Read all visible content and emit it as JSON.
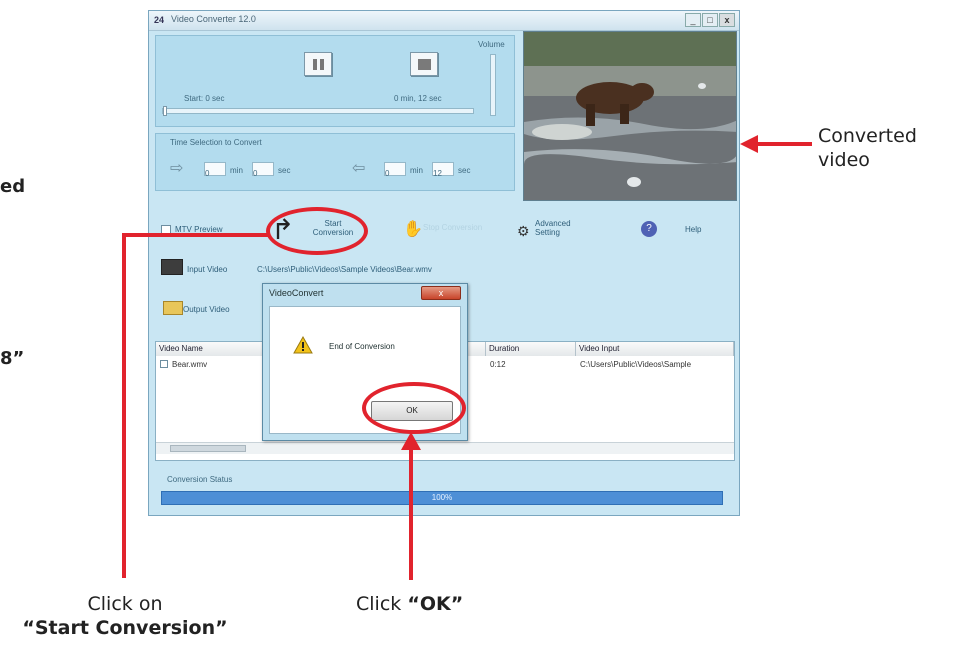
{
  "side_fragments": {
    "top": "ed",
    "middle": "8”"
  },
  "window": {
    "title": "Video Converter 12.0",
    "controls": {
      "minimize": "_",
      "maximize": "□",
      "close": "x"
    },
    "player": {
      "volume_label": "Volume",
      "start_time": "Start: 0 sec",
      "end_time": "0 min, 12 sec"
    },
    "selection": {
      "label": "Time Selection to Convert",
      "start_min": "0",
      "start_min_unit": "min",
      "start_sec": "0",
      "start_sec_unit": "sec",
      "end_min": "0",
      "end_min_unit": "min",
      "end_sec": "12",
      "end_sec_unit": "sec"
    },
    "toolbar": {
      "mtv_preview": "MTV Preview",
      "start_conversion": "Start Conversion",
      "stop": "Stop Conversion",
      "advanced_setting": "Advanced Setting",
      "help": "Help"
    },
    "input_video": {
      "label": "Input Video",
      "path": "C:\\Users\\Public\\Videos\\Sample Videos\\Bear.wmv"
    },
    "output_video": {
      "label": "Output Video"
    },
    "list": {
      "columns": [
        "Video Name",
        "Duration",
        "Video Input"
      ],
      "rows": [
        {
          "name": "Bear.wmv",
          "duration": "0:12",
          "input": "C:\\Users\\Public\\Videos\\Sample"
        }
      ]
    },
    "status": {
      "label": "Conversion Status",
      "progress": 100,
      "progress_text": "100%"
    }
  },
  "dialog": {
    "title": "VideoConvert",
    "close_label": "x",
    "message": "End of Conversion",
    "ok_label": "OK"
  },
  "callouts": {
    "converted_line1": "Converted",
    "converted_line2": "video",
    "start_line1": "Click on",
    "start_line2": "“Start Conversion”",
    "ok_prefix": "Click",
    "ok_bold": "“OK”"
  },
  "colors": {
    "annotation_red": "#e1232d",
    "progress_blue": "#4d8fd6"
  }
}
